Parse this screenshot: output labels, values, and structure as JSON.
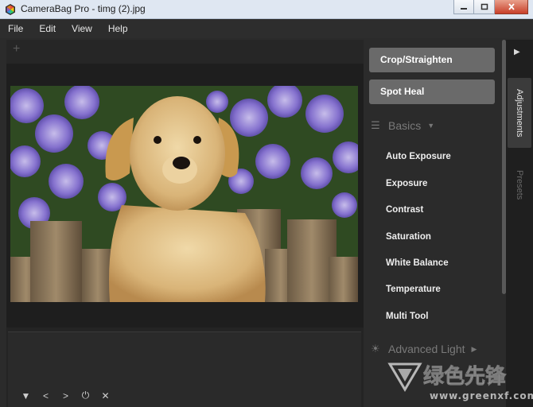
{
  "window": {
    "title": "CameraBag Pro - timg (2).jpg"
  },
  "menu": [
    "File",
    "Edit",
    "View",
    "Help"
  ],
  "toolbar": {
    "add_symbol": "+"
  },
  "tools": {
    "crop_label": "Crop/Straighten",
    "spot_heal_label": "Spot Heal"
  },
  "basics": {
    "label": "Basics",
    "items": [
      "Auto Exposure",
      "Exposure",
      "Contrast",
      "Saturation",
      "White Balance",
      "Temperature",
      "Multi Tool"
    ]
  },
  "advanced": {
    "label": "Advanced Light"
  },
  "tabs": {
    "adjustments": "Adjustments",
    "presets": "Presets"
  },
  "filmstrip_controls": [
    "▼",
    "<",
    ">",
    "⏻",
    "✕"
  ],
  "watermark": {
    "text_cn": "绿色先锋",
    "url": "www.greenxf.com"
  },
  "colors": {
    "accent_button": "#6a6a6a",
    "panel_bg": "#2b2b2b",
    "titlebar_bg": "#dfe7f2"
  }
}
